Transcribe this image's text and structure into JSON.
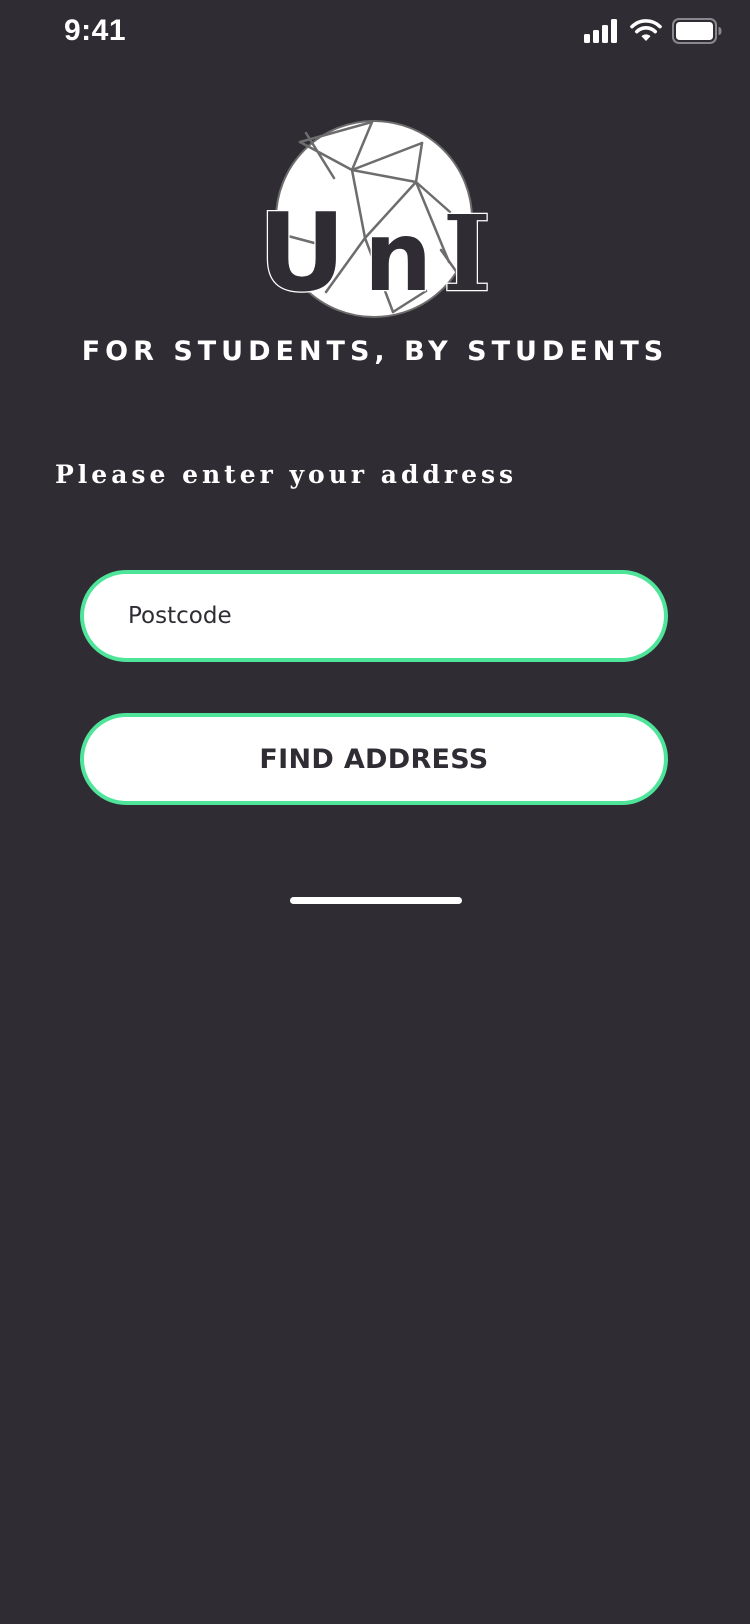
{
  "status_bar": {
    "time": "9:41"
  },
  "logo": {
    "text_letters": [
      "U",
      "n",
      "I"
    ]
  },
  "tagline": "FOR STUDENTS, BY STUDENTS",
  "prompt": "Please enter your address",
  "postcode_field": {
    "placeholder": "Postcode",
    "value": ""
  },
  "find_button": {
    "label": "FIND ADDRESS"
  },
  "colors": {
    "background": "#2f2c34",
    "accent": "#4ee59a",
    "field_fill": "#ffffff",
    "text_dark": "#2f2c34"
  },
  "icons": [
    "cellular-signal-icon",
    "wifi-icon",
    "battery-icon"
  ]
}
